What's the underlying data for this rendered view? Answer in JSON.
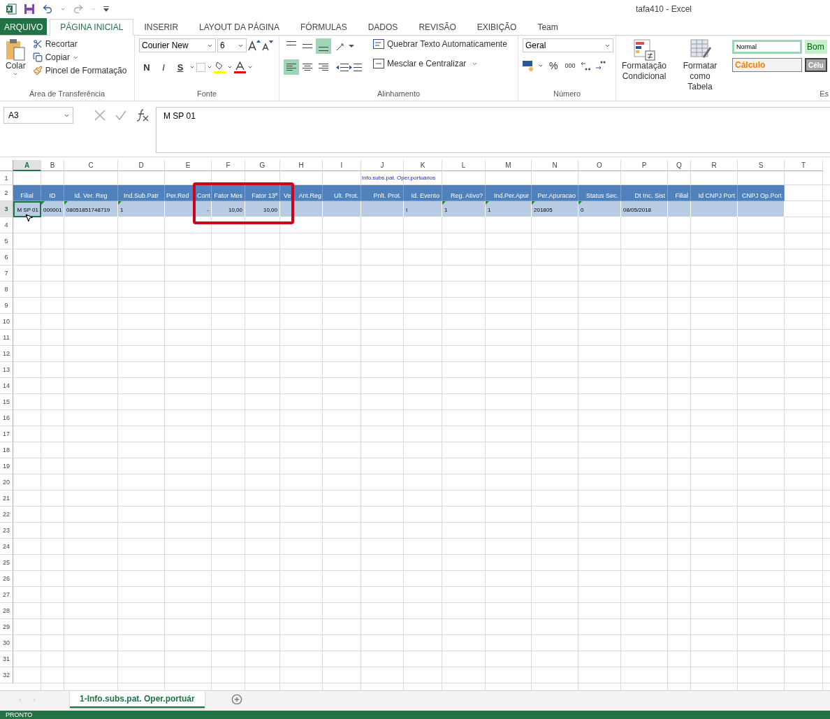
{
  "window": {
    "title": "tafa410 - Excel"
  },
  "ribbon_tabs": [
    {
      "label": "ARQUIVO",
      "kind": "file",
      "selected": false
    },
    {
      "label": "PÁGINA INICIAL",
      "kind": "tab",
      "selected": true
    },
    {
      "label": "INSERIR",
      "kind": "tab",
      "selected": false
    },
    {
      "label": "LAYOUT DA PÁGINA",
      "kind": "tab",
      "selected": false
    },
    {
      "label": "FÓRMULAS",
      "kind": "tab",
      "selected": false
    },
    {
      "label": "DADOS",
      "kind": "tab",
      "selected": false
    },
    {
      "label": "REVISÃO",
      "kind": "tab",
      "selected": false
    },
    {
      "label": "EXIBIÇÃO",
      "kind": "tab",
      "selected": false
    },
    {
      "label": "Team",
      "kind": "tab",
      "selected": false
    }
  ],
  "clipboard": {
    "paste": "Colar",
    "cut": "Recortar",
    "copy": "Copiar",
    "painter": "Pincel de Formatação",
    "label": "Área de Transferência"
  },
  "font": {
    "name": "Courier New",
    "size": "6",
    "bold": "N",
    "italic": "I",
    "underline": "S",
    "label": "Fonte"
  },
  "alignment": {
    "vertical": [
      {
        "selected": false
      },
      {
        "selected": false
      },
      {
        "selected": true
      }
    ],
    "horizontal": [
      {
        "selected": true
      },
      {
        "selected": false
      },
      {
        "selected": false
      }
    ],
    "wrap": "Quebrar Texto Automaticamente",
    "merge": "Mesclar e Centralizar",
    "label": "Alinhamento"
  },
  "number": {
    "format": "Geral",
    "percent": "%",
    "thousands": "000",
    "label": "Número"
  },
  "styles": {
    "conditional": [
      "Formatação",
      "Condicional"
    ],
    "as_table": [
      "Formatar como",
      "Tabela"
    ],
    "cells": [
      {
        "label": "Normal",
        "kind": "normal"
      },
      {
        "label": "Bom",
        "kind": "good"
      },
      {
        "label": "Cálculo",
        "kind": "calc"
      },
      {
        "label": "Célu",
        "kind": "check"
      }
    ],
    "label": "Es"
  },
  "formula_bar": {
    "name_box": "A3",
    "formula": "M SP 01"
  },
  "sheet": {
    "columns": [
      {
        "label": "A",
        "selected": true
      },
      {
        "label": "B",
        "selected": false
      },
      {
        "label": "C",
        "selected": false
      },
      {
        "label": "D",
        "selected": false
      },
      {
        "label": "E",
        "selected": false
      },
      {
        "label": "F",
        "selected": false
      },
      {
        "label": "G",
        "selected": false
      },
      {
        "label": "H",
        "selected": false
      },
      {
        "label": "I",
        "selected": false
      },
      {
        "label": "J",
        "selected": false
      },
      {
        "label": "K",
        "selected": false
      },
      {
        "label": "L",
        "selected": false
      },
      {
        "label": "M",
        "selected": false
      },
      {
        "label": "N",
        "selected": false
      },
      {
        "label": "O",
        "selected": false
      },
      {
        "label": "P",
        "selected": false
      },
      {
        "label": "Q",
        "selected": false
      },
      {
        "label": "R",
        "selected": false
      },
      {
        "label": "S",
        "selected": false
      },
      {
        "label": "T",
        "selected": false
      }
    ],
    "rows": [
      {
        "label": "1",
        "selected": false
      },
      {
        "label": "2",
        "selected": false
      },
      {
        "label": "3",
        "selected": true
      },
      {
        "label": "4",
        "selected": false
      },
      {
        "label": "5",
        "selected": false
      },
      {
        "label": "6",
        "selected": false
      },
      {
        "label": "7",
        "selected": false
      },
      {
        "label": "8",
        "selected": false
      },
      {
        "label": "9",
        "selected": false
      },
      {
        "label": "10",
        "selected": false
      },
      {
        "label": "11",
        "selected": false
      },
      {
        "label": "12",
        "selected": false
      },
      {
        "label": "13",
        "selected": false
      },
      {
        "label": "14",
        "selected": false
      },
      {
        "label": "15",
        "selected": false
      },
      {
        "label": "16",
        "selected": false
      },
      {
        "label": "17",
        "selected": false
      },
      {
        "label": "18",
        "selected": false
      },
      {
        "label": "19",
        "selected": false
      },
      {
        "label": "20",
        "selected": false
      },
      {
        "label": "21",
        "selected": false
      },
      {
        "label": "22",
        "selected": false
      },
      {
        "label": "23",
        "selected": false
      },
      {
        "label": "24",
        "selected": false
      },
      {
        "label": "25",
        "selected": false
      },
      {
        "label": "26",
        "selected": false
      },
      {
        "label": "27",
        "selected": false
      },
      {
        "label": "28",
        "selected": false
      },
      {
        "label": "29",
        "selected": false
      },
      {
        "label": "30",
        "selected": false
      },
      {
        "label": "31",
        "selected": false
      },
      {
        "label": "32",
        "selected": false
      }
    ],
    "title": "Info.subs.pat. Oper.portuários",
    "headers": [
      {
        "text": "Filial",
        "kind": "plain"
      },
      {
        "text": "ID",
        "kind": "plain"
      },
      {
        "text": "Id. Ver. Reg",
        "kind": "plain"
      },
      {
        "text": "Ind.Sub.Patr",
        "kind": "plain"
      },
      {
        "text": "Per.Red Cont",
        "kind": "split"
      },
      {
        "text": "Fator Mes",
        "kind": "plain"
      },
      {
        "text": "Fator 13ª",
        "kind": "plain"
      },
      {
        "text": "Ve Ant.Reg",
        "kind": "split"
      },
      {
        "text": "Ult. Prot.",
        "kind": "plain"
      },
      {
        "text": "Pnlt. Prot.",
        "kind": "plain"
      },
      {
        "text": "Id. Evento",
        "kind": "plain"
      },
      {
        "text": "Reg. Ativo?",
        "kind": "plain"
      },
      {
        "text": "Ind.Per.Apur",
        "kind": "plain"
      },
      {
        "text": "Per.Apuracao",
        "kind": "plain"
      },
      {
        "text": "Status Sec.",
        "kind": "plain"
      },
      {
        "text": "Dt Inc. Sist",
        "kind": "plain"
      },
      {
        "text": "Filial",
        "kind": "plain"
      },
      {
        "text": "Id CNPJ Port",
        "kind": "plain"
      },
      {
        "text": "CNPJ Op.Port",
        "kind": "plain"
      }
    ],
    "data": [
      {
        "text": "M SP 01",
        "kind": "number",
        "flag": false,
        "selected": true
      },
      {
        "text": "000001",
        "kind": "text",
        "flag": true,
        "selected": false
      },
      {
        "text": "08051851748719",
        "kind": "text",
        "flag": true,
        "selected": false
      },
      {
        "text": "1",
        "kind": "text",
        "flag": true,
        "selected": false
      },
      {
        "text": "-",
        "kind": "number",
        "flag": false,
        "selected": false
      },
      {
        "text": "10,00",
        "kind": "number",
        "flag": false,
        "selected": false
      },
      {
        "text": "10,00",
        "kind": "number",
        "flag": false,
        "selected": false
      },
      {
        "kind": "text",
        "flag": false,
        "selected": false
      },
      {
        "kind": "text",
        "flag": false,
        "selected": false
      },
      {
        "kind": "text",
        "flag": false,
        "selected": false
      },
      {
        "text": "I",
        "kind": "text",
        "flag": false,
        "selected": false
      },
      {
        "text": "1",
        "kind": "text",
        "flag": true,
        "selected": false
      },
      {
        "text": "1",
        "kind": "text",
        "flag": true,
        "selected": false
      },
      {
        "text": "201805",
        "kind": "text",
        "flag": true,
        "selected": false
      },
      {
        "text": "0",
        "kind": "text",
        "flag": true,
        "selected": false
      },
      {
        "text": "08/05/2018",
        "kind": "text",
        "flag": false,
        "selected": false
      },
      {
        "kind": "text",
        "flag": false,
        "selected": false
      },
      {
        "kind": "text",
        "flag": false,
        "selected": false
      },
      {
        "kind": "text",
        "flag": false,
        "selected": false
      }
    ]
  },
  "sheet_tabs": [
    {
      "label": "1-Info.subs.pat. Oper.portuár",
      "selected": true
    }
  ],
  "status_bar": {
    "text": "PRONTO"
  }
}
